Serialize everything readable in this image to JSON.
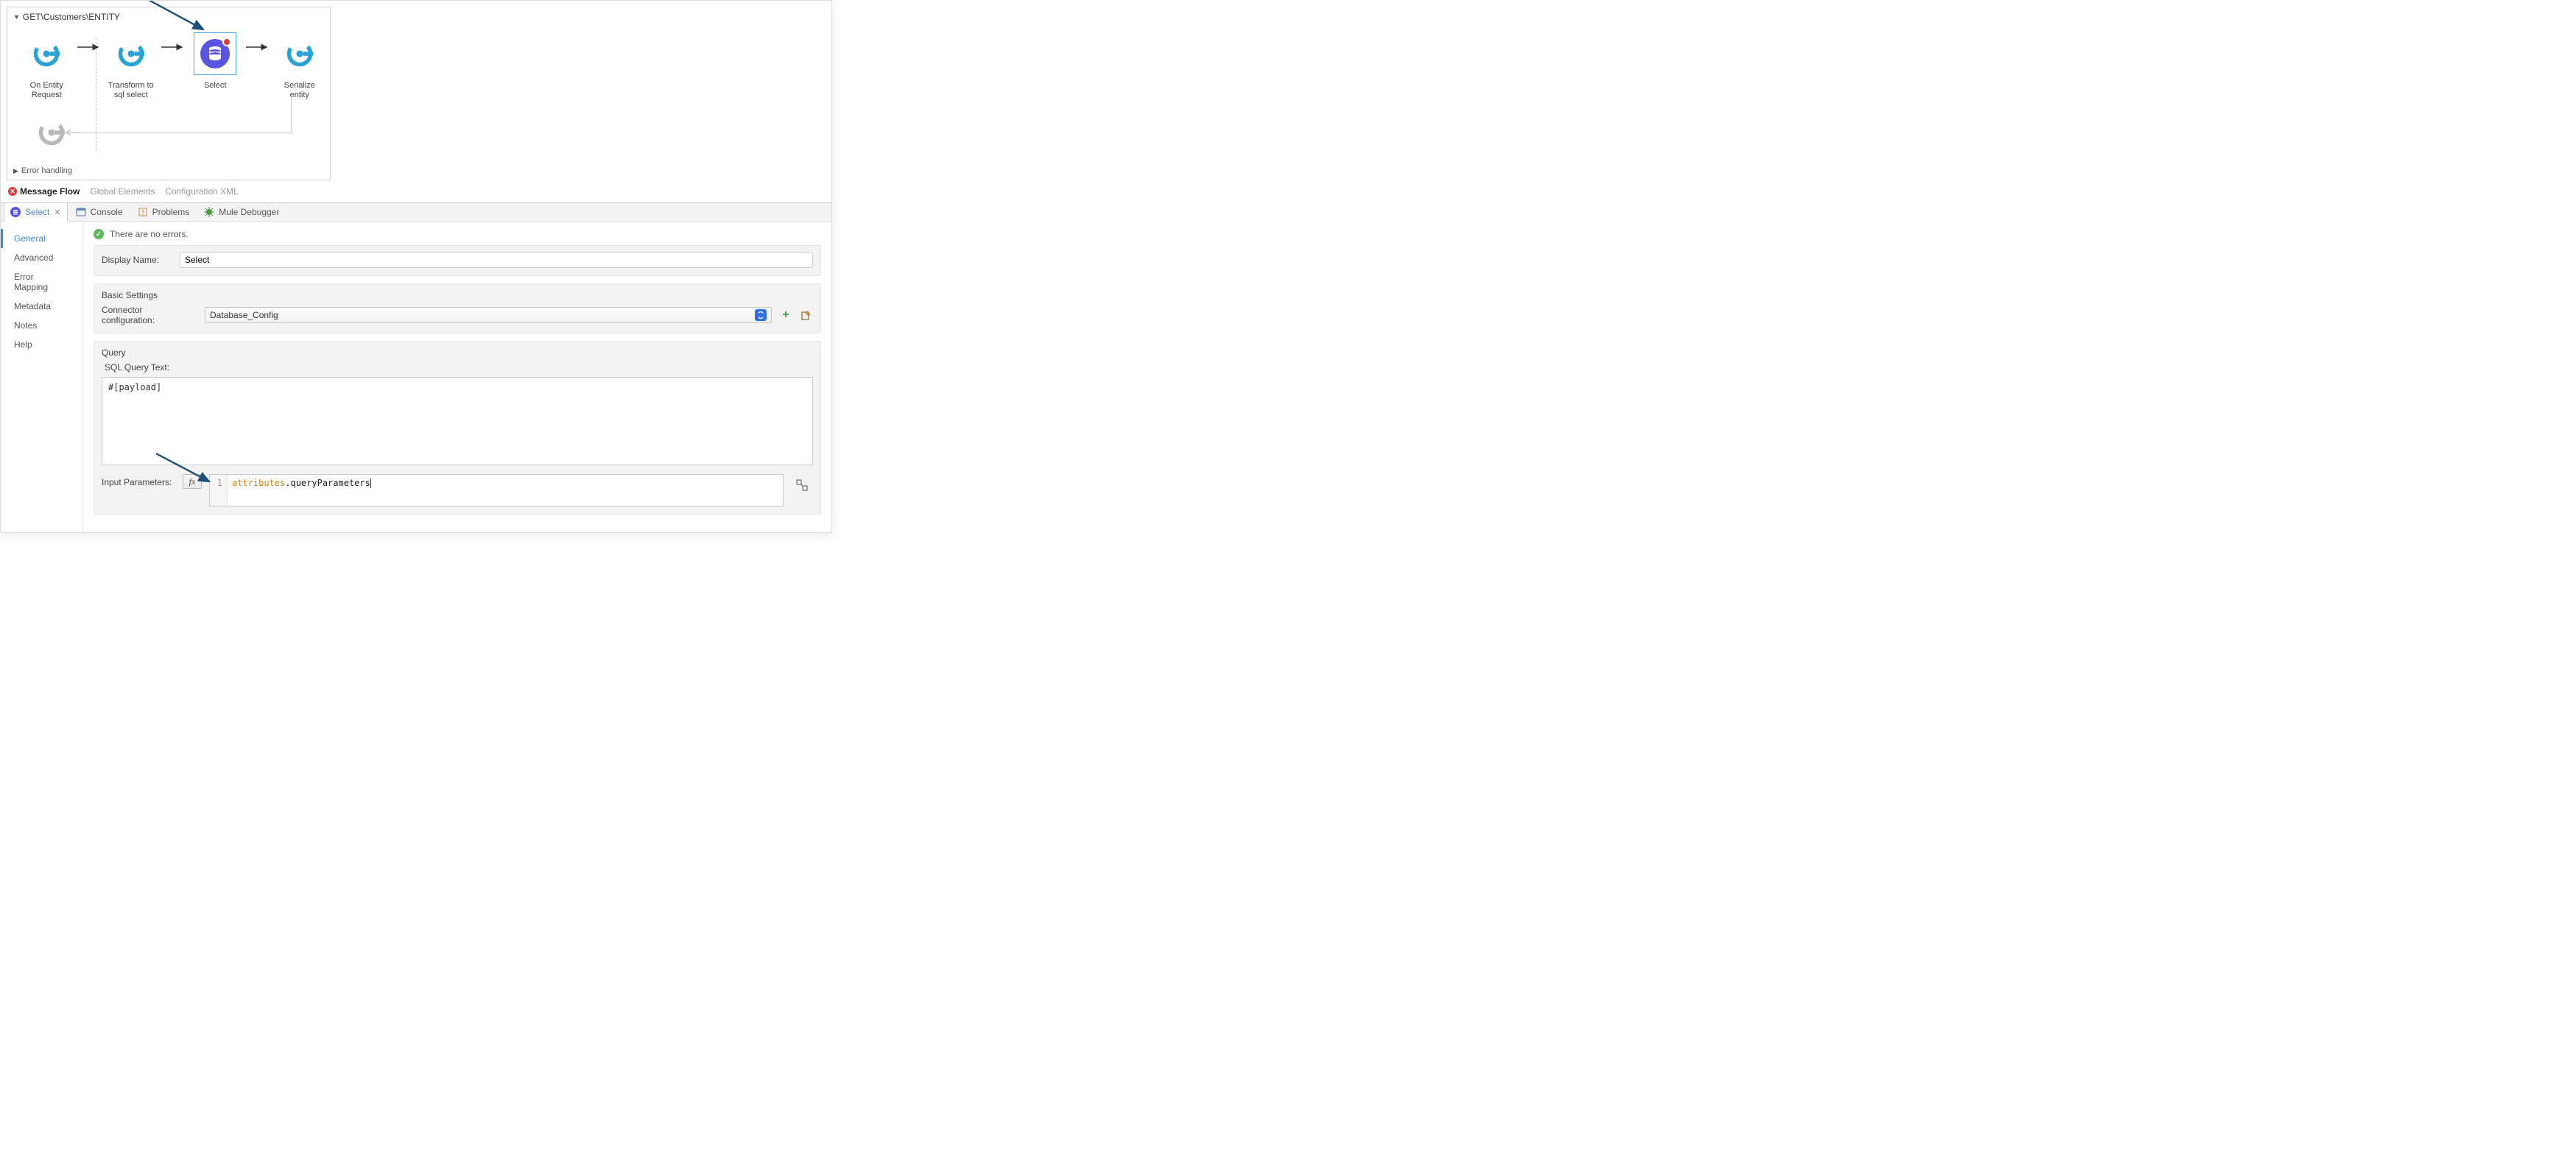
{
  "flow": {
    "title": "GET\\Customers\\ENTITY",
    "nodes": {
      "n0": "On Entity Request",
      "n1": "Transform to sql select",
      "n2": "Select",
      "n3": "Serialize entity"
    },
    "error_section": "Error handling"
  },
  "flow_tabs": {
    "message_flow": "Message Flow",
    "global_elements": "Global Elements",
    "config_xml": "Configuration XML"
  },
  "panel_tabs": {
    "select": "Select",
    "console": "Console",
    "problems": "Problems",
    "debugger": "Mule Debugger"
  },
  "side": {
    "general": "General",
    "advanced": "Advanced",
    "error_mapping": "Error Mapping",
    "metadata": "Metadata",
    "notes": "Notes",
    "help": "Help"
  },
  "form": {
    "status": "There are no errors.",
    "display_name_label": "Display Name:",
    "display_name_value": "Select",
    "basic_settings_label": "Basic Settings",
    "connector_label": "Connector configuration:",
    "connector_value": "Database_Config",
    "query_label": "Query",
    "sql_label": "SQL Query Text:",
    "sql_value": "#[payload]",
    "input_params_label": "Input Parameters:",
    "fx_label": "fx",
    "gutter_1": "1",
    "code_attr": "attributes",
    "code_rest": ".queryParameters"
  }
}
